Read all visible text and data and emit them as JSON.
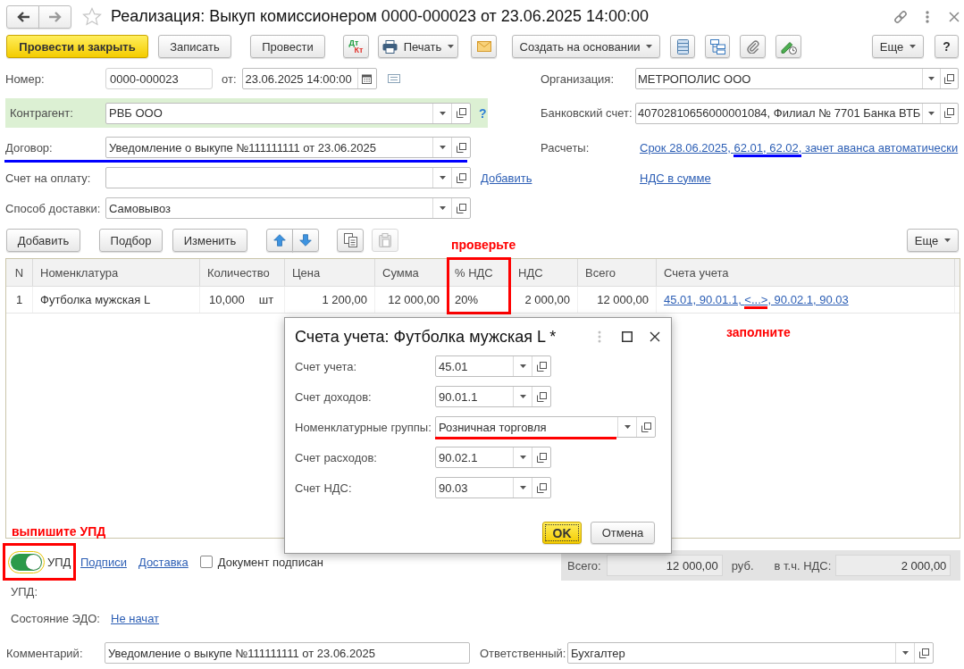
{
  "window": {
    "title": "Реализация: Выкуп комиссионером 0000-000023 от 23.06.2025 14:00:00",
    "favorite": false
  },
  "toolbar": {
    "buttons": [
      {
        "kind": "primary",
        "label": "Провести и закрыть"
      },
      {
        "kind": "plain",
        "label": "Записать"
      },
      {
        "kind": "plain",
        "label": "Провести"
      },
      {
        "kind": "menu",
        "label": "Печать"
      },
      {
        "kind": "menu",
        "label": "Создать на основании"
      },
      {
        "kind": "menu",
        "label": "Еще"
      },
      {
        "kind": "help",
        "label": "?"
      }
    ],
    "entries_button": {
      "debit": "Дт",
      "credit": "Кт"
    }
  },
  "header": {
    "left": [
      {
        "kind": "number",
        "label": "Номер:",
        "value": "0000-000023",
        "date_label": "от:",
        "date": "23.06.2025 14:00:00",
        "highlighted": false
      },
      {
        "kind": "select",
        "label": "Контрагент:",
        "value": "РВБ ООО",
        "help": "?",
        "highlighted": true
      },
      {
        "kind": "select",
        "label": "Договор:",
        "value": "Уведомление о выкупе №111111111 от 23.06.2025",
        "underline": {
          "color": "#0000ff"
        },
        "highlighted": false
      },
      {
        "kind": "select",
        "label": "Счет на оплату:",
        "link": "Добавить",
        "highlighted": false
      },
      {
        "kind": "select",
        "label": "Способ доставки:",
        "value": "Самовывоз",
        "highlighted": false
      }
    ],
    "right": [
      {
        "kind": "select",
        "label": "Организация:",
        "value": "МЕТРОПОЛИС ООО"
      },
      {
        "kind": "select",
        "label": "Банковский счет:",
        "value": "40702810656000001084, Филиал № 7701 Банка ВТБ"
      },
      {
        "kind": "link",
        "label": "Расчеты:",
        "segments": [
          {
            "text": "Срок 28.06.2025, "
          },
          {
            "text": "62.01, 62.02,",
            "underline": {
              "color": "#0000ff"
            }
          },
          {
            "text": " зачет аванса автоматически"
          }
        ]
      },
      {
        "kind": "link",
        "segments": [
          {
            "text": "НДС в сумме"
          }
        ]
      }
    ]
  },
  "table_toolbar": {
    "buttons": [
      {
        "label": "Добавить"
      },
      {
        "label": "Подбор"
      },
      {
        "label": "Изменить"
      }
    ],
    "icon_buttons": [
      {
        "disabled": false
      },
      {
        "disabled": false
      },
      {
        "disabled": false
      },
      {
        "disabled": true
      }
    ],
    "more": "Еще"
  },
  "table": {
    "columns": [
      {
        "label": "N",
        "framed": false
      },
      {
        "label": "Номенклатура",
        "framed": false
      },
      {
        "label": "Количество",
        "framed": false
      },
      {
        "label": "Цена",
        "framed": false
      },
      {
        "label": "Сумма",
        "framed": false
      },
      {
        "label": "% НДС",
        "framed": true,
        "note": "проверьте"
      },
      {
        "label": "НДС",
        "framed": false
      },
      {
        "label": "Всего",
        "framed": false
      },
      {
        "label": "Счета учета",
        "framed": false
      }
    ],
    "rows": [
      {
        "n": "1",
        "item": "Футболка мужская L",
        "quantity": "10,000",
        "unit": "шт",
        "price": "1 200,00",
        "amount": "12 000,00",
        "vat_rate": "20%",
        "vat": "2 000,00",
        "total": "12 000,00",
        "accounts": [
          {
            "text": "45.01, 90.01.1, "
          },
          {
            "text": "<...>",
            "underline": {
              "color": "#ff0000"
            }
          },
          {
            "text": ", 90.02.1, 90.03"
          }
        ]
      }
    ]
  },
  "dialog": {
    "title": "Счета учета: Футболка мужская L *",
    "note": "заполните",
    "fields": [
      {
        "kind": "short",
        "label": "Счет учета:",
        "value": "45.01"
      },
      {
        "kind": "short",
        "label": "Счет доходов:",
        "value": "90.01.1"
      },
      {
        "kind": "wide",
        "label": "Номенклатурные группы:",
        "value": "Розничная торговля",
        "underline": {
          "color": "#ff0000"
        }
      },
      {
        "kind": "short",
        "label": "Счет расходов:",
        "value": "90.02.1"
      },
      {
        "kind": "short",
        "label": "Счет НДС:",
        "value": "90.03"
      }
    ],
    "buttons": [
      {
        "kind": "default",
        "label": "OK"
      },
      {
        "kind": "plain",
        "label": "Отмена"
      }
    ]
  },
  "edo": {
    "toggle": {
      "label": "УПД",
      "on": true,
      "framed": true,
      "note": "выпишите УПД"
    },
    "links": [
      "Подписи",
      "Доставка"
    ],
    "signed": {
      "label": "Документ подписан",
      "checked": false
    },
    "upd_label": "УПД:",
    "status_label": "Состояние ЭДО:",
    "status": "Не начат"
  },
  "totals": {
    "total_label": "Всего:",
    "total": "12 000,00",
    "currency": "руб.",
    "vat_label": "в т.ч. НДС:",
    "vat": "2 000,00"
  },
  "comment": {
    "label": "Комментарий:",
    "value": "Уведомление о выкупе №111111111 от 23.06.2025"
  },
  "responsible": {
    "label": "Ответственный:",
    "value": "Бухгалтер"
  }
}
